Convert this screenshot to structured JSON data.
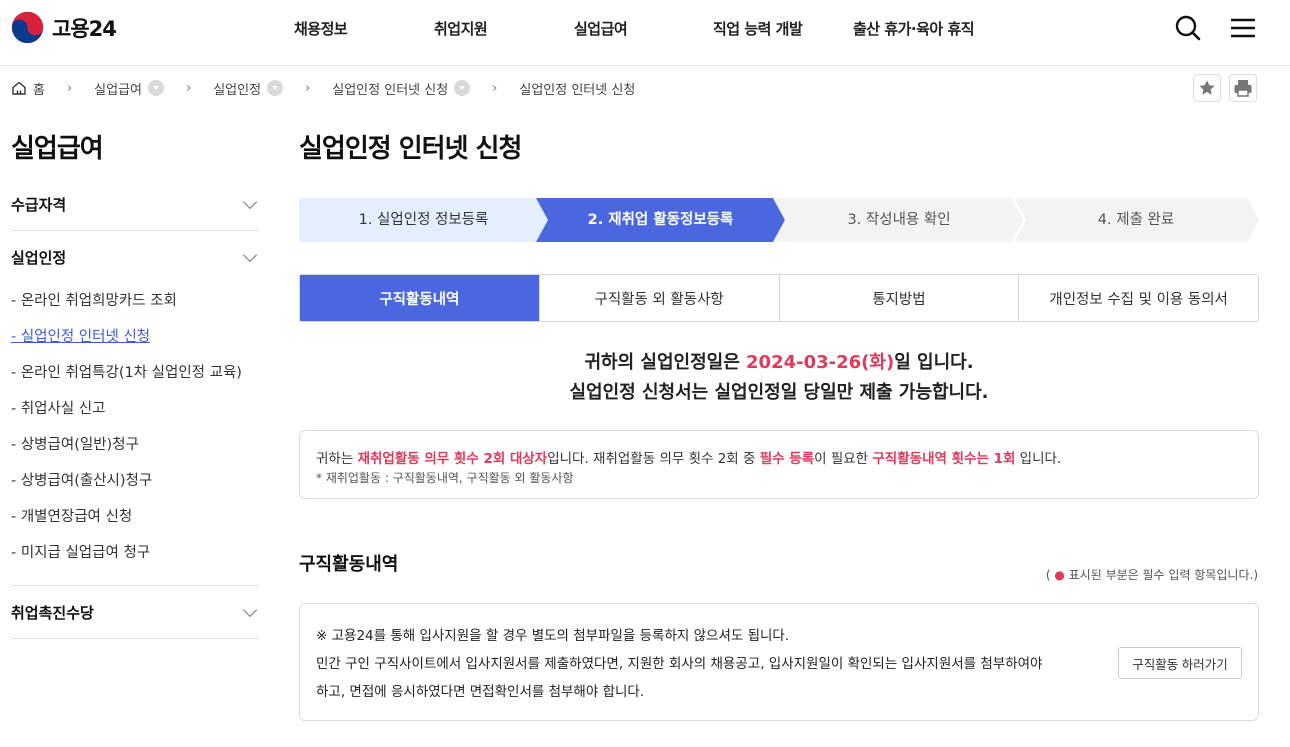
{
  "header": {
    "logo_text": "고용24",
    "nav": [
      "채용정보",
      "취업지원",
      "실업급여",
      "직업 능력 개발",
      "출산 휴가·육아 휴직"
    ],
    "search_icon": "search-icon",
    "menu_icon": "hamburger-menu-icon"
  },
  "breadcrumb": {
    "home": "홈",
    "items": [
      "실업급여",
      "실업인정",
      "실업인정 인터넷 신청",
      "실업인정 인터넷 신청"
    ]
  },
  "toolbar": {
    "favorite_icon": "star-icon",
    "print_icon": "print-icon"
  },
  "lnb": {
    "title": "실업급여",
    "groups": [
      {
        "label": "수급자격",
        "items": []
      },
      {
        "label": "실업인정",
        "items": [
          "- 온라인 취업희망카드 조회",
          "- 실업인정 인터넷 신청",
          "- 온라인 취업특강(1차 실업인정 교육)",
          "- 취업사실 신고",
          "- 상병급여(일반)청구",
          "- 상병급여(출산시)청구",
          "- 개별연장급여 신청",
          "- 미지급 실업급여 청구"
        ]
      },
      {
        "label": "취업촉진수당",
        "items": []
      }
    ]
  },
  "main": {
    "title": "실업인정 인터넷 신청",
    "steps": [
      "1. 실업인정 정보등록",
      "2. 재취업 활동정보등록",
      "3. 작성내용 확인",
      "4. 제출 완료"
    ],
    "tabs": [
      "구직활동내역",
      "구직활동 외 활동사항",
      "통지방법",
      "개인정보 수집 및 이용 동의서"
    ],
    "notice": {
      "line1_pre": "귀하의 실업인정일은 ",
      "line1_date": "2024-03-26(화)",
      "line1_post": "일 입니다.",
      "line2": "실업인정 신청서는 실업인정일 당일만 제출 가능합니다."
    },
    "info": {
      "p1": "귀하는 ",
      "h1": "재취업활동 의무 횟수 2회 대상자",
      "p2": "입니다. 재취업활동 의무 횟수 2회 중 ",
      "h2": "필수 등록",
      "p3": "이 필요한 ",
      "h3": "구직활동내역 횟수는 1회",
      "p4": " 입니다.",
      "note": "* 재취업활동 : 구직활동내역, 구직활동 외 활동사항"
    },
    "section_title": "구직활동내역",
    "required_note": {
      "open": "( ",
      "dot": "●",
      "text": " 표시된 부분은 필수 입력 항목입니다.)"
    },
    "guide": {
      "line1": "※ 고용24를 통해 입사지원을 할 경우 별도의 첨부파일을 등록하지 않으셔도 됩니다.",
      "line2": "민간 구인 구직사이트에서 입사지원서를 제출하였다면, 지원한 회사의 채용공고, 입사지원일이 확인되는 입사지원서를 첨부하여야",
      "line3": "하고, 면접에 응시하였다면 면접확인서를 첨부해야 합니다.",
      "button": "구직활동 하러가기"
    }
  }
}
